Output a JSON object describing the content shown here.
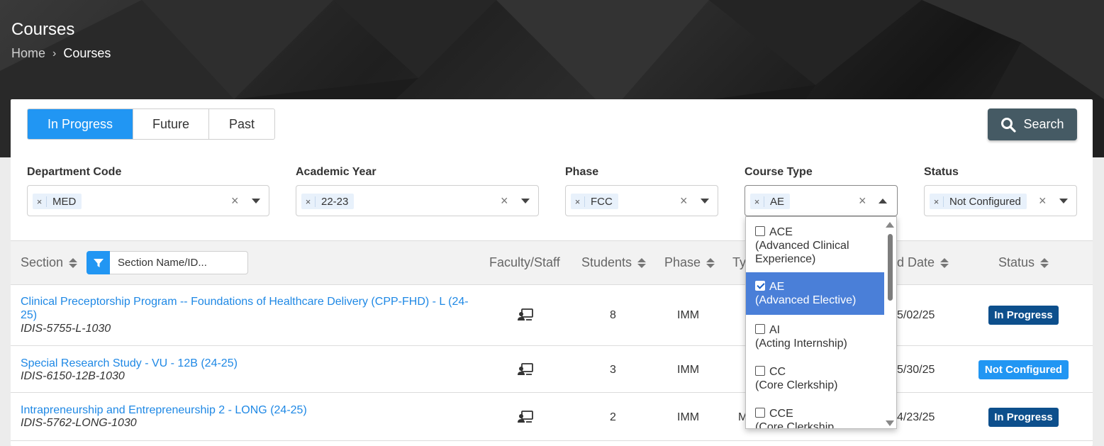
{
  "header": {
    "title": "Courses",
    "breadcrumb": {
      "home": "Home",
      "separator": "›",
      "current": "Courses"
    }
  },
  "tabs": [
    {
      "label": "In Progress",
      "active": true
    },
    {
      "label": "Future",
      "active": false
    },
    {
      "label": "Past",
      "active": false
    }
  ],
  "search_button": {
    "label": "Search",
    "icon": "search-icon"
  },
  "filters": {
    "department": {
      "label": "Department Code",
      "value": "MED"
    },
    "academic_year": {
      "label": "Academic Year",
      "value": "22-23"
    },
    "phase": {
      "label": "Phase",
      "value": "FCC"
    },
    "course_type": {
      "label": "Course Type",
      "value": "AE"
    },
    "status": {
      "label": "Status",
      "value": "Not Configured"
    }
  },
  "chip_remove": "×",
  "clear_glyph": "×",
  "table": {
    "headers": {
      "section": "Section",
      "section_placeholder": "Section Name/ID...",
      "faculty": "Faculty/Staff",
      "students": "Students",
      "phase": "Phase",
      "type_partial": "Ty",
      "end_date_partial": "d Date",
      "status": "Status"
    },
    "rows": [
      {
        "title": "Clinical Preceptorship Program -- Foundations of Healthcare Delivery (CPP-FHD) - L (24-25)",
        "code": "IDIS-5755-L-1030",
        "students": "8",
        "phase": "IMM",
        "type_partial": "",
        "end_date_partial": "5/02/25",
        "status": "In Progress"
      },
      {
        "title": "Special Research Study - VU - 12B (24-25)",
        "code": "IDIS-6150-12B-1030",
        "students": "3",
        "phase": "IMM",
        "type_partial": "",
        "end_date_partial": "5/30/25",
        "status": "Not Configured"
      },
      {
        "title": "Intrapreneurship and Entrepreneurship 2 - LONG (24-25)",
        "code": "IDIS-5762-LONG-1030",
        "students": "2",
        "phase": "IMM",
        "type_partial": "M",
        "end_date_partial": "4/23/25",
        "status": "In Progress"
      }
    ]
  },
  "course_type_dropdown": {
    "options": [
      {
        "code": "ACE",
        "desc": "(Advanced Clinical Experience)",
        "checked": false
      },
      {
        "code": "AE",
        "desc": "(Advanced Elective)",
        "checked": true
      },
      {
        "code": "AI",
        "desc": "(Acting Internship)",
        "checked": false
      },
      {
        "code": "CC",
        "desc": "(Core Clerkship)",
        "checked": false
      },
      {
        "code": "CCE",
        "desc": "(Core Clerkship",
        "checked": false
      }
    ]
  },
  "colors": {
    "primary": "#2196f3",
    "search_button": "#455a64",
    "badge_in_progress": "#0d4f8c",
    "badge_not_configured": "#2196f3",
    "selected_option": "#4a7fd8",
    "link": "#1e88e5"
  }
}
